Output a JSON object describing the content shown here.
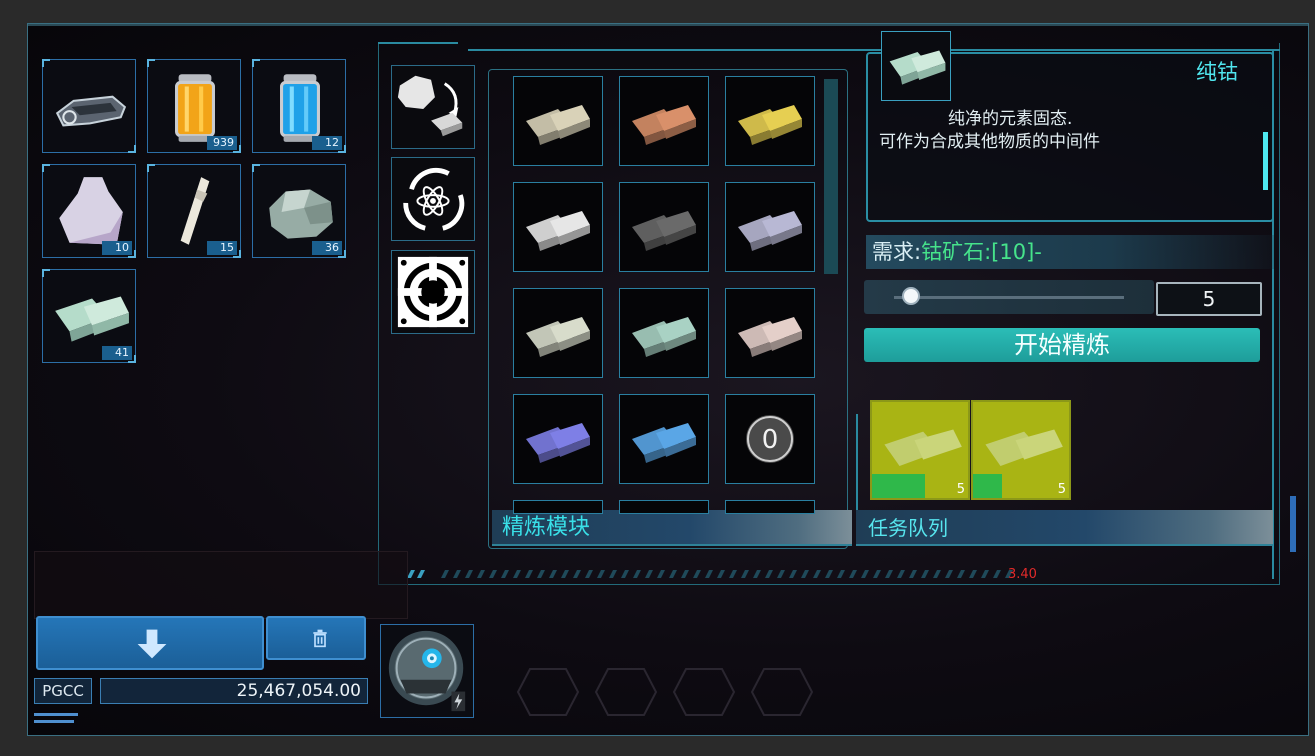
{
  "inventory": [
    {
      "id": "ship-part",
      "count": ""
    },
    {
      "id": "orange-canister",
      "count": "939"
    },
    {
      "id": "blue-canister",
      "count": "12"
    },
    {
      "id": "white-plate",
      "count": "10"
    },
    {
      "id": "white-rod",
      "count": "15"
    },
    {
      "id": "ore-chunk",
      "count": "36"
    },
    {
      "id": "cobalt-ingot",
      "count": "41"
    }
  ],
  "recipe_tabs": [
    {
      "name": "refine-tab-icon"
    },
    {
      "name": "atom-recycle-icon"
    },
    {
      "name": "target-module-icon"
    }
  ],
  "ingot_grid_colors": [
    [
      "#d9d2b8",
      "#d9906a",
      "#e6cf52"
    ],
    [
      "#e6e6e6",
      "#6a6a6a",
      "#b8b8d4"
    ],
    [
      "#d8dccb",
      "#a9d2c4",
      "#e4cfc9"
    ],
    [
      "#7e7fe6",
      "#5aa6e6",
      "orb"
    ]
  ],
  "orb_label": "0",
  "panel": {
    "module_label": "精炼模块",
    "queue_label": "任务队列"
  },
  "info": {
    "title": "纯钴",
    "desc_line1": "纯净的元素固态.",
    "desc_line2": "可作为合成其他物质的中间件"
  },
  "requirement": {
    "prefix": "需求:",
    "item": "钴矿石:[10]-"
  },
  "slider": {
    "value": 0.05
  },
  "quantity": "5",
  "start_button": "开始精炼",
  "queue": [
    {
      "count": "5",
      "progress": 0.55
    },
    {
      "count": "5",
      "progress": 0.3
    }
  ],
  "status_value": "3.40",
  "currency": {
    "code": "PGCC",
    "amount": "25,467,054.00"
  },
  "colors": {
    "accent_cyan": "#39e0e8",
    "button_blue": "#2576b8",
    "start_teal": "#2bbdb7",
    "queue_yellow": "#a9b414",
    "status_red": "#e12a2a"
  }
}
